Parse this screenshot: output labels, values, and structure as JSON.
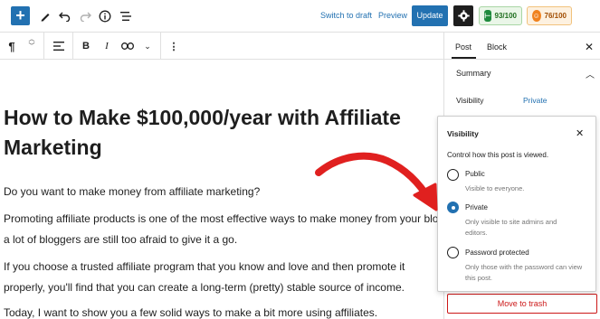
{
  "topbar": {
    "switch_to_draft": "Switch to draft",
    "preview": "Preview",
    "update": "Update",
    "seo_score": "93/100",
    "readability_score": "76/100"
  },
  "content": {
    "title": "How to Make $100,000/year with Affiliate Marketing",
    "paragraphs": [
      "Do you want to make money from affiliate marketing?",
      "Promoting affiliate products is one of the most effective ways to make money from your blog. But a lot of bloggers are still too afraid to give it a go.",
      "If you choose a trusted affiliate program that you know and love and then promote it properly, you'll find that you can create a long-term (pretty) stable source of income.",
      "Today, I want to show you a few solid ways to make a bit more using affiliates."
    ]
  },
  "sidebar": {
    "tabs": [
      "Post",
      "Block"
    ],
    "active_tab": "Post",
    "section_title": "Summary",
    "visibility_label": "Visibility",
    "visibility_value": "Private",
    "trash_label": "Move to trash"
  },
  "visibility_popover": {
    "title": "Visibility",
    "description": "Control how this post is viewed.",
    "options": [
      {
        "label": "Public",
        "help": "Visible to everyone.",
        "checked": false
      },
      {
        "label": "Private",
        "help": "Only visible to site admins and editors.",
        "checked": true
      },
      {
        "label": "Password protected",
        "help": "Only those with the password can view this post.",
        "checked": false
      }
    ]
  },
  "colors": {
    "accent": "#2271b1",
    "annotation_arrow": "#e0201f",
    "danger": "#cc1818"
  }
}
